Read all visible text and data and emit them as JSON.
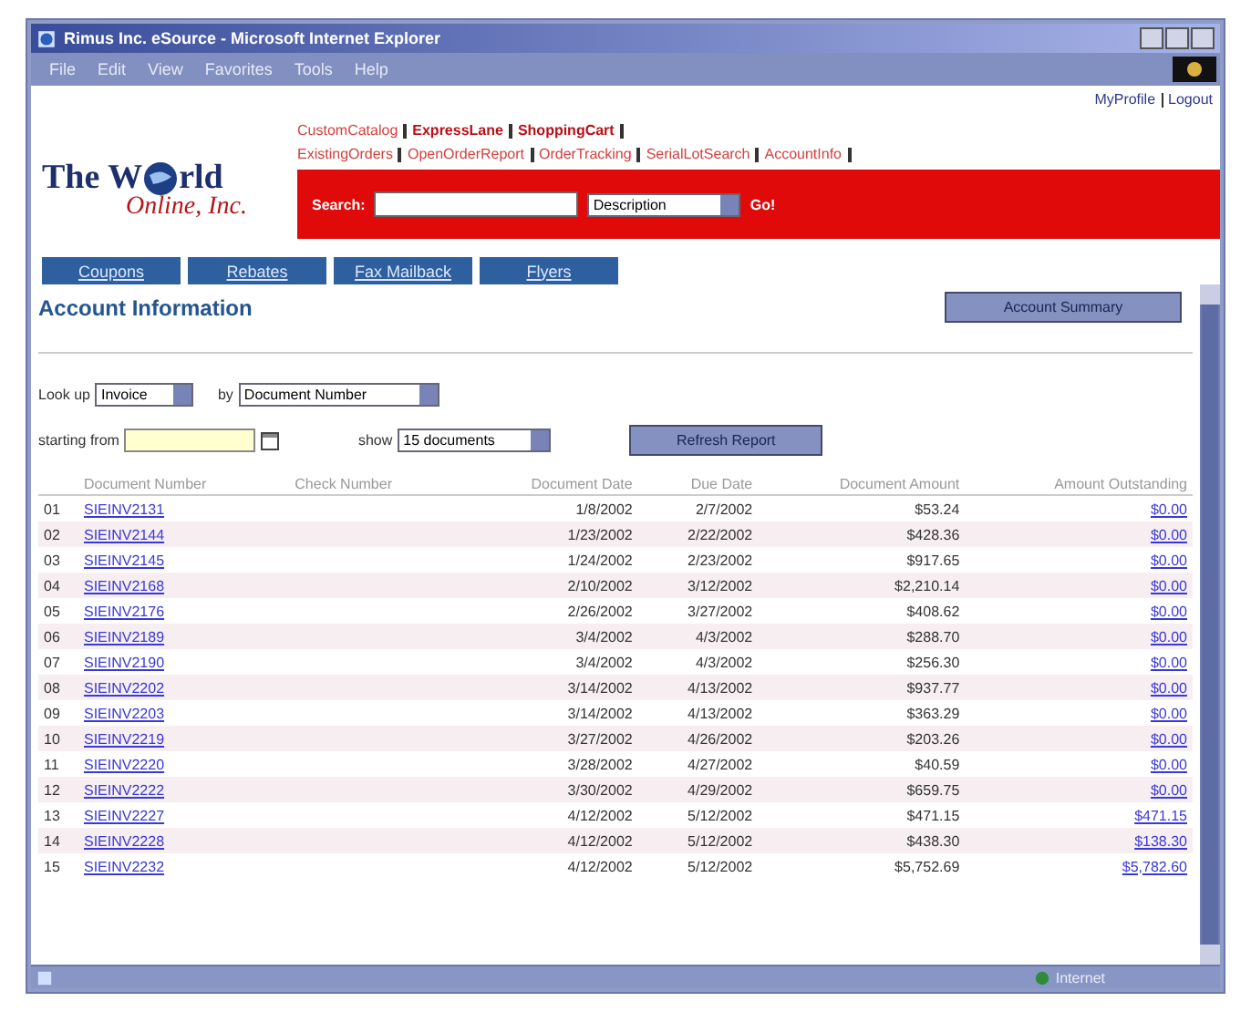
{
  "window": {
    "title": "Rimus Inc. eSource - Microsoft Internet Explorer"
  },
  "menu": [
    "File",
    "Edit",
    "View",
    "Favorites",
    "Tools",
    "Help"
  ],
  "user_links": [
    "MyProfile",
    "Logout"
  ],
  "nav_rows": [
    [
      {
        "label": "CustomCatalog",
        "bold": false
      },
      {
        "label": "ExpressLane",
        "bold": true
      },
      {
        "label": "ShoppingCart",
        "bold": true
      }
    ],
    [
      {
        "label": "ExistingOrders",
        "bold": false
      },
      {
        "label": "OpenOrderReport",
        "bold": false
      },
      {
        "label": "OrderTracking",
        "bold": false
      },
      {
        "label": "SerialLotSearch",
        "bold": false
      },
      {
        "label": "AccountInfo",
        "bold": false
      }
    ]
  ],
  "logo": {
    "line1": "The W",
    "line1_end": "rld",
    "line2": "Online, Inc."
  },
  "search": {
    "label": "Search:",
    "scope": "Description",
    "go": "Go!"
  },
  "tabs": [
    "Coupons",
    "Rebates",
    "Fax Mailback",
    "Flyers"
  ],
  "heading": "Account Information",
  "summary_button": "Account Summary",
  "filters": {
    "lookup_label": "Look up",
    "lookup_value": "Invoice",
    "by_label": "by",
    "by_value": "Document Number",
    "start_label": "starting from",
    "show_label": "show",
    "show_value": "15 documents",
    "refresh": "Refresh Report"
  },
  "table": {
    "columns": [
      "Document Number",
      "Check Number",
      "Document Date",
      "Due Date",
      "Document Amount",
      "Amount Outstanding"
    ],
    "rows": [
      {
        "index": "01",
        "document": "SIEINV2131",
        "date": "1/8/2002",
        "due": "2/7/2002",
        "amount": "$53.24",
        "outstanding": "$0.00"
      },
      {
        "index": "02",
        "document": "SIEINV2144",
        "date": "1/23/2002",
        "due": "2/22/2002",
        "amount": "$428.36",
        "outstanding": "$0.00"
      },
      {
        "index": "03",
        "document": "SIEINV2145",
        "date": "1/24/2002",
        "due": "2/23/2002",
        "amount": "$917.65",
        "outstanding": "$0.00"
      },
      {
        "index": "04",
        "document": "SIEINV2168",
        "date": "2/10/2002",
        "due": "3/12/2002",
        "amount": "$2,210.14",
        "outstanding": "$0.00"
      },
      {
        "index": "05",
        "document": "SIEINV2176",
        "date": "2/26/2002",
        "due": "3/27/2002",
        "amount": "$408.62",
        "outstanding": "$0.00"
      },
      {
        "index": "06",
        "document": "SIEINV2189",
        "date": "3/4/2002",
        "due": "4/3/2002",
        "amount": "$288.70",
        "outstanding": "$0.00"
      },
      {
        "index": "07",
        "document": "SIEINV2190",
        "date": "3/4/2002",
        "due": "4/3/2002",
        "amount": "$256.30",
        "outstanding": "$0.00"
      },
      {
        "index": "08",
        "document": "SIEINV2202",
        "date": "3/14/2002",
        "due": "4/13/2002",
        "amount": "$937.77",
        "outstanding": "$0.00"
      },
      {
        "index": "09",
        "document": "SIEINV2203",
        "date": "3/14/2002",
        "due": "4/13/2002",
        "amount": "$363.29",
        "outstanding": "$0.00"
      },
      {
        "index": "10",
        "document": "SIEINV2219",
        "date": "3/27/2002",
        "due": "4/26/2002",
        "amount": "$203.26",
        "outstanding": "$0.00"
      },
      {
        "index": "11",
        "document": "SIEINV2220",
        "date": "3/28/2002",
        "due": "4/27/2002",
        "amount": "$40.59",
        "outstanding": "$0.00"
      },
      {
        "index": "12",
        "document": "SIEINV2222",
        "date": "3/30/2002",
        "due": "4/29/2002",
        "amount": "$659.75",
        "outstanding": "$0.00"
      },
      {
        "index": "13",
        "document": "SIEINV2227",
        "date": "4/12/2002",
        "due": "5/12/2002",
        "amount": "$471.15",
        "outstanding": "$471.15"
      },
      {
        "index": "14",
        "document": "SIEINV2228",
        "date": "4/12/2002",
        "due": "5/12/2002",
        "amount": "$438.30",
        "outstanding": "$138.30"
      },
      {
        "index": "15",
        "document": "SIEINV2232",
        "date": "4/12/2002",
        "due": "5/12/2002",
        "amount": "$5,752.69",
        "outstanding": "$5,782.60"
      }
    ]
  },
  "status_bar": {
    "zone": "Internet"
  }
}
